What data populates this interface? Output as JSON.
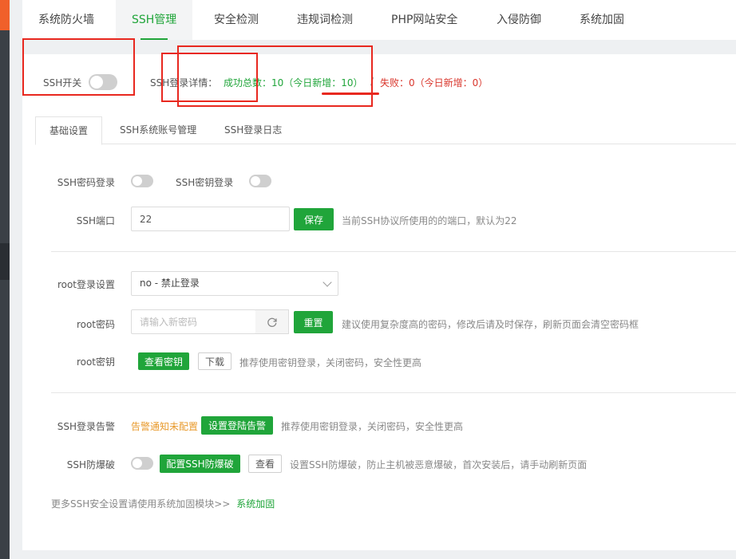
{
  "top_tabs": [
    "系统防火墙",
    "SSH管理",
    "安全检测",
    "违规词检测",
    "PHP网站安全",
    "入侵防御",
    "系统加固"
  ],
  "header": {
    "ssh_switch_label": "SSH开关",
    "ssh_login_detail_label": "SSH登录详情：",
    "success_text": "成功总数：10（今日新增：10）",
    "separator": "/",
    "fail_text": "失败：0（今日新增：0）"
  },
  "sub_tabs": [
    "基础设置",
    "SSH系统账号管理",
    "SSH登录日志"
  ],
  "basic": {
    "password_login_label": "SSH密码登录",
    "key_login_label": "SSH密钥登录",
    "port_label": "SSH端口",
    "port_value": "22",
    "save_label": "保存",
    "port_hint": "当前SSH协议所使用的的端口，默认为22"
  },
  "root": {
    "login_setting_label": "root登录设置",
    "login_setting_value": "no - 禁止登录",
    "password_label": "root密码",
    "password_placeholder": "请输入新密码",
    "reset_label": "重置",
    "password_hint": "建议使用复杂度高的密码，修改后请及时保存，刷新页面会清空密码框",
    "key_label": "root密钥",
    "view_key_label": "查看密钥",
    "download_label": "下载",
    "key_hint": "推荐使用密钥登录，关闭密码，安全性更高"
  },
  "alert": {
    "label": "SSH登录告警",
    "status": "告警通知未配置",
    "button": "设置登陆告警",
    "hint": "推荐使用密钥登录，关闭密码，安全性更高"
  },
  "bruteforce": {
    "label": "SSH防爆破",
    "config_button": "配置SSH防爆破",
    "view_button": "查看",
    "hint": "设置SSH防爆破，防止主机被恶意爆破，首次安装后，请手动刷新页面"
  },
  "footer": {
    "text": "更多SSH安全设置请使用系统加固模块>>",
    "link": "系统加固"
  },
  "colors": {
    "accent": "#20a53a",
    "danger": "#d9352b",
    "warning": "#e89a2c",
    "annotation": "#e8281f"
  }
}
